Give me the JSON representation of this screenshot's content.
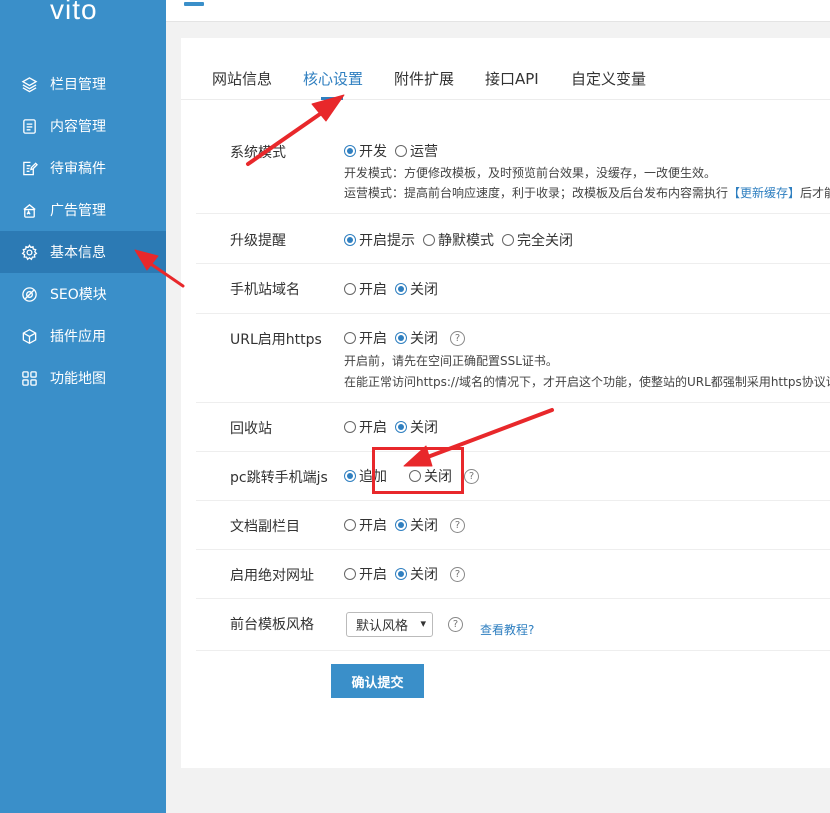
{
  "brand": {
    "logo": "vito"
  },
  "sidebar": {
    "items": [
      {
        "label": "栏目管理",
        "icon": "layers-icon"
      },
      {
        "label": "内容管理",
        "icon": "document-icon"
      },
      {
        "label": "待审稿件",
        "icon": "edit-document-icon"
      },
      {
        "label": "广告管理",
        "icon": "ad-icon"
      },
      {
        "label": "基本信息",
        "icon": "gear-icon"
      },
      {
        "label": "SEO模块",
        "icon": "seo-icon"
      },
      {
        "label": "插件应用",
        "icon": "cube-icon"
      },
      {
        "label": "功能地图",
        "icon": "grid-icon"
      }
    ],
    "active_index": 4
  },
  "tabs": [
    {
      "label": "网站信息"
    },
    {
      "label": "核心设置"
    },
    {
      "label": "附件扩展"
    },
    {
      "label": "接口API"
    },
    {
      "label": "自定义变量"
    }
  ],
  "active_tab": 1,
  "settings": {
    "system_mode": {
      "label": "系统模式",
      "opt1": "开发",
      "opt2": "运营",
      "hint1": "开发模式：方便修改模板，及时预览前台效果，没缓存，一改便生效。",
      "hint2_a": "运营模式：提高前台响应速度，利于收录；改模板及后台发布内容需执行",
      "hint2_link": "【更新缓存】",
      "hint2_b": "后才能在"
    },
    "upgrade": {
      "label": "升级提醒",
      "opt1": "开启提示",
      "opt2": "静默模式",
      "opt3": "完全关闭"
    },
    "mobile_domain": {
      "label": "手机站域名",
      "opt1": "开启",
      "opt2": "关闭"
    },
    "https": {
      "label": "URL启用https",
      "opt1": "开启",
      "opt2": "关闭",
      "hint1": "开启前，请先在空间正确配置SSL证书。",
      "hint2": "在能正常访问https://域名的情况下，才开启这个功能，使整站的URL都强制采用https协议访问"
    },
    "recycle": {
      "label": "回收站",
      "opt1": "开启",
      "opt2": "关闭"
    },
    "pc_jump": {
      "label": "pc跳转手机端js",
      "opt1": "追加",
      "opt2": "关闭"
    },
    "sub_column": {
      "label": "文档副栏目",
      "opt1": "开启",
      "opt2": "关闭"
    },
    "absolute_url": {
      "label": "启用绝对网址",
      "opt1": "开启",
      "opt2": "关闭"
    },
    "template_style": {
      "label": "前台模板风格",
      "selected": "默认风格",
      "tutorial": "查看教程?"
    },
    "help_glyph": "?"
  },
  "submit_label": "确认提交",
  "colors": {
    "sidebar": "#3a8fc9",
    "sidebar_active": "#2c7ab4",
    "accent": "#2f7fc0",
    "annotation": "#e8282b"
  }
}
